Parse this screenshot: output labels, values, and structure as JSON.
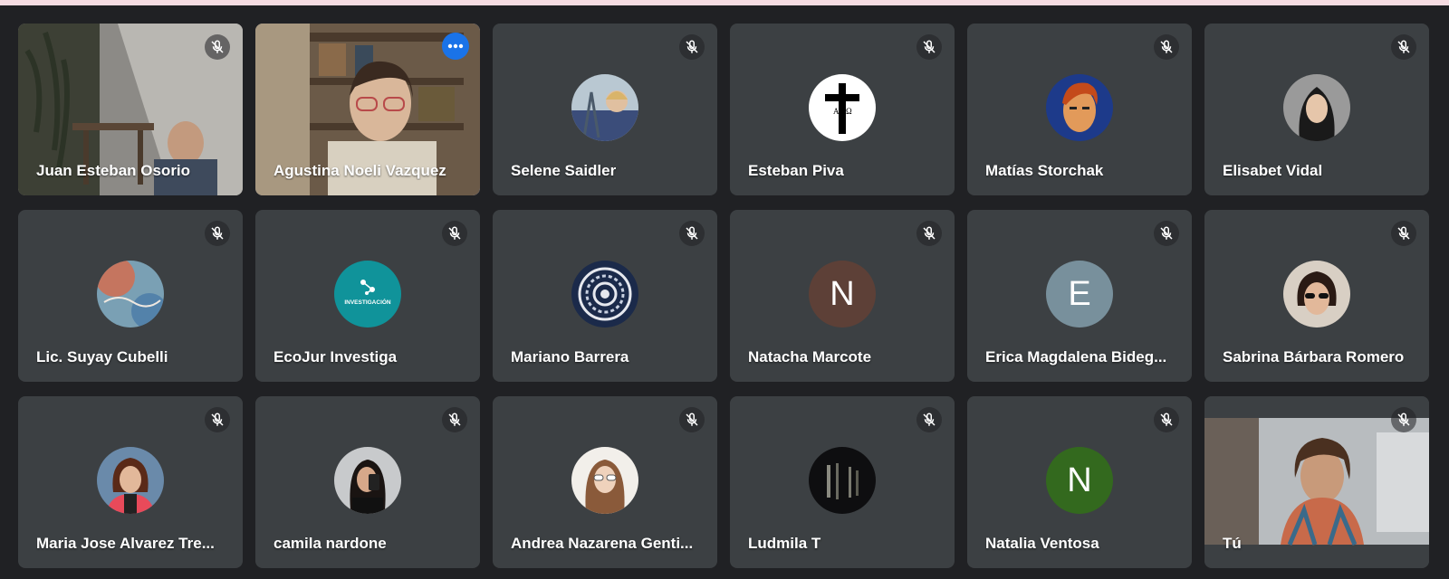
{
  "colors": {
    "background": "#202124",
    "tile": "#3c4043",
    "active_outline": "#8ab4f8",
    "more_button": "#1a73e8"
  },
  "participants": [
    {
      "name": "Juan Esteban Osorio",
      "type": "video"
    },
    {
      "name": "Agustina Noeli Vazquez",
      "type": "video"
    },
    {
      "name": "Selene Saidler",
      "type": "photo"
    },
    {
      "name": "Esteban Piva",
      "type": "photo"
    },
    {
      "name": "Matías Storchak",
      "type": "photo"
    },
    {
      "name": "Elisabet Vidal",
      "type": "photo"
    },
    {
      "name": "Lic. Suyay Cubelli",
      "type": "photo"
    },
    {
      "name": "EcoJur Investiga",
      "type": "photo",
      "avatar_text": "INVESTIGACIÓN"
    },
    {
      "name": "Mariano Barrera",
      "type": "photo"
    },
    {
      "name": "Natacha Marcote",
      "type": "letter",
      "letter": "N",
      "color": "#5d4037"
    },
    {
      "name": "Erica Magdalena Bideg...",
      "type": "letter",
      "letter": "E",
      "color": "#78909c"
    },
    {
      "name": "Sabrina Bárbara Romero",
      "type": "photo"
    },
    {
      "name": "Maria Jose Alvarez Tre...",
      "type": "photo"
    },
    {
      "name": "camila nardone",
      "type": "photo"
    },
    {
      "name": "Andrea Nazarena Genti...",
      "type": "photo"
    },
    {
      "name": "Ludmila T",
      "type": "photo"
    },
    {
      "name": "Natalia Ventosa",
      "type": "letter",
      "letter": "N",
      "color": "#33691e"
    },
    {
      "name": "Tú",
      "type": "video"
    }
  ]
}
